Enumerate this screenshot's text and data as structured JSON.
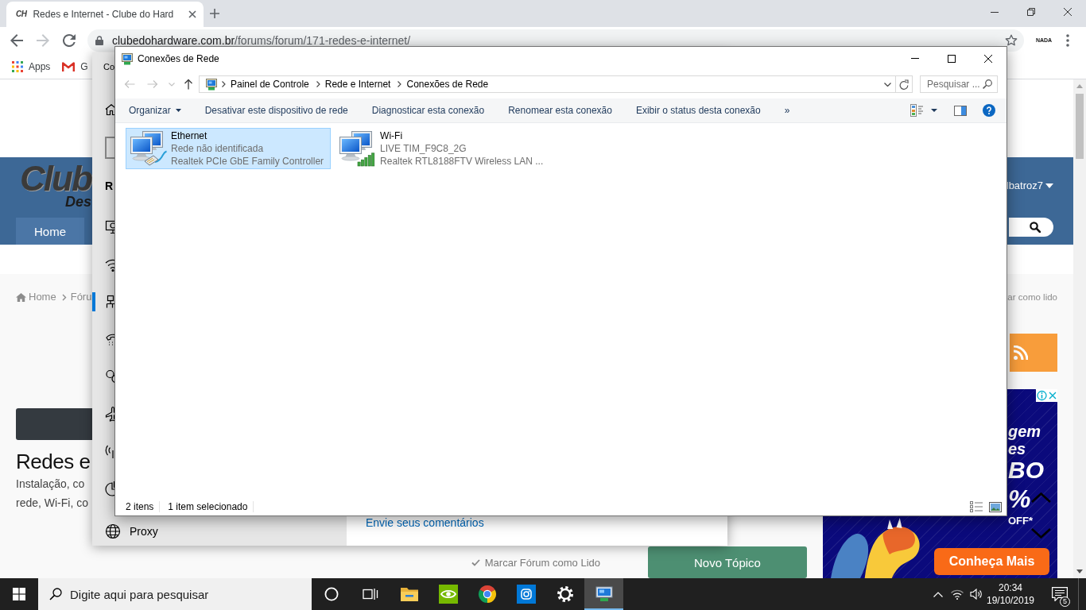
{
  "browser": {
    "tab": {
      "favicon": "CH",
      "title": "Redes e Internet - Clube do Hard"
    },
    "nav_buttons": [
      {
        "kind": "back",
        "disabled": false
      },
      {
        "kind": "forward",
        "disabled": true
      },
      {
        "kind": "reload",
        "disabled": false
      }
    ],
    "address": {
      "domain": "clubedohardware.com.br",
      "path": "/forums/forum/171-redes-e-internet/"
    },
    "extension": "NADA",
    "bookmarks": [
      {
        "kind": "apps",
        "label": "Apps"
      },
      {
        "kind": "gmail",
        "label": "G"
      }
    ]
  },
  "page": {
    "logo": {
      "wordmark": "Club",
      "tagline": "Des"
    },
    "nav": [
      "Home"
    ],
    "user": "lbatroz7",
    "breadcrumb": [
      "Home",
      "Fóru"
    ],
    "mark_read": "ar como lido",
    "heading": "Redes e",
    "description": [
      "Instalação, co",
      "rede, Wi-Fi, co"
    ],
    "mark_forum_read": "Marcar Fórum como Lido",
    "new_topic": "Novo Tópico",
    "ad": {
      "texts": [
        {
          "kind": "headline",
          "text": "gem"
        },
        {
          "kind": "headline",
          "text": "es"
        },
        {
          "kind": "brand",
          "text": "BO"
        },
        {
          "kind": "discount",
          "text": "%"
        },
        {
          "kind": "note",
          "text": "OFF*"
        }
      ],
      "button": "Conheça Mais"
    }
  },
  "settings_window": {
    "title": "Co",
    "heading": "R",
    "nav_items": [
      {
        "kind": "status",
        "selected": false
      },
      {
        "kind": "wifi",
        "selected": false
      },
      {
        "kind": "ethernet",
        "selected": true
      },
      {
        "kind": "dialup",
        "selected": false
      },
      {
        "kind": "vpn",
        "selected": false
      },
      {
        "kind": "airplane",
        "selected": false
      },
      {
        "kind": "hotspot",
        "selected": false
      },
      {
        "kind": "data_usage",
        "selected": false
      },
      {
        "kind": "proxy",
        "label": "Proxy",
        "selected": false
      }
    ],
    "feedback_link": "Envie seus comentários"
  },
  "explorer": {
    "title": "Conexões de Rede",
    "nav_buttons": [
      {
        "kind": "back",
        "disabled": true
      },
      {
        "kind": "forward",
        "disabled": true
      },
      {
        "kind": "recent",
        "disabled": true
      },
      {
        "kind": "up",
        "disabled": false
      }
    ],
    "breadcrumb": [
      "Painel de Controle",
      "Rede e Internet",
      "Conexões de Rede"
    ],
    "search": {
      "placeholder": "Pesquisar ..."
    },
    "commands": [
      {
        "kind": "menu",
        "label": "Organizar"
      },
      {
        "kind": "action",
        "label": "Desativar este dispositivo de rede"
      },
      {
        "kind": "action",
        "label": "Diagnosticar esta conexão"
      },
      {
        "kind": "action",
        "label": "Renomear esta conexão"
      },
      {
        "kind": "action",
        "label": "Exibir o status desta conexão"
      },
      {
        "kind": "more",
        "label": "»"
      }
    ],
    "connections": [
      {
        "kind": "ethernet",
        "name": "Ethernet",
        "status": "Rede não identificada",
        "adapter": "Realtek PCIe GbE Family Controller",
        "selected": true
      },
      {
        "kind": "wifi",
        "name": "Wi-Fi",
        "status": "LIVE TIM_F9C8_2G",
        "adapter": "Realtek RTL8188FTV Wireless LAN ...",
        "selected": false
      }
    ],
    "status_bar": {
      "count": "2 itens",
      "selection": "1 item selecionado"
    }
  },
  "taskbar": {
    "search": {
      "placeholder": "Digite aqui para pesquisar"
    },
    "apps": [
      {
        "kind": "cortana",
        "selected": false
      },
      {
        "kind": "task_view",
        "selected": false
      },
      {
        "kind": "file_explorer",
        "selected": false
      },
      {
        "kind": "nvidia",
        "selected": false
      },
      {
        "kind": "chrome",
        "selected": false
      },
      {
        "kind": "camera",
        "selected": false
      },
      {
        "kind": "settings",
        "selected": false
      },
      {
        "kind": "network_connections",
        "selected": true
      }
    ],
    "time": "20:34",
    "date": "19/10/2019",
    "notifications": "5"
  }
}
